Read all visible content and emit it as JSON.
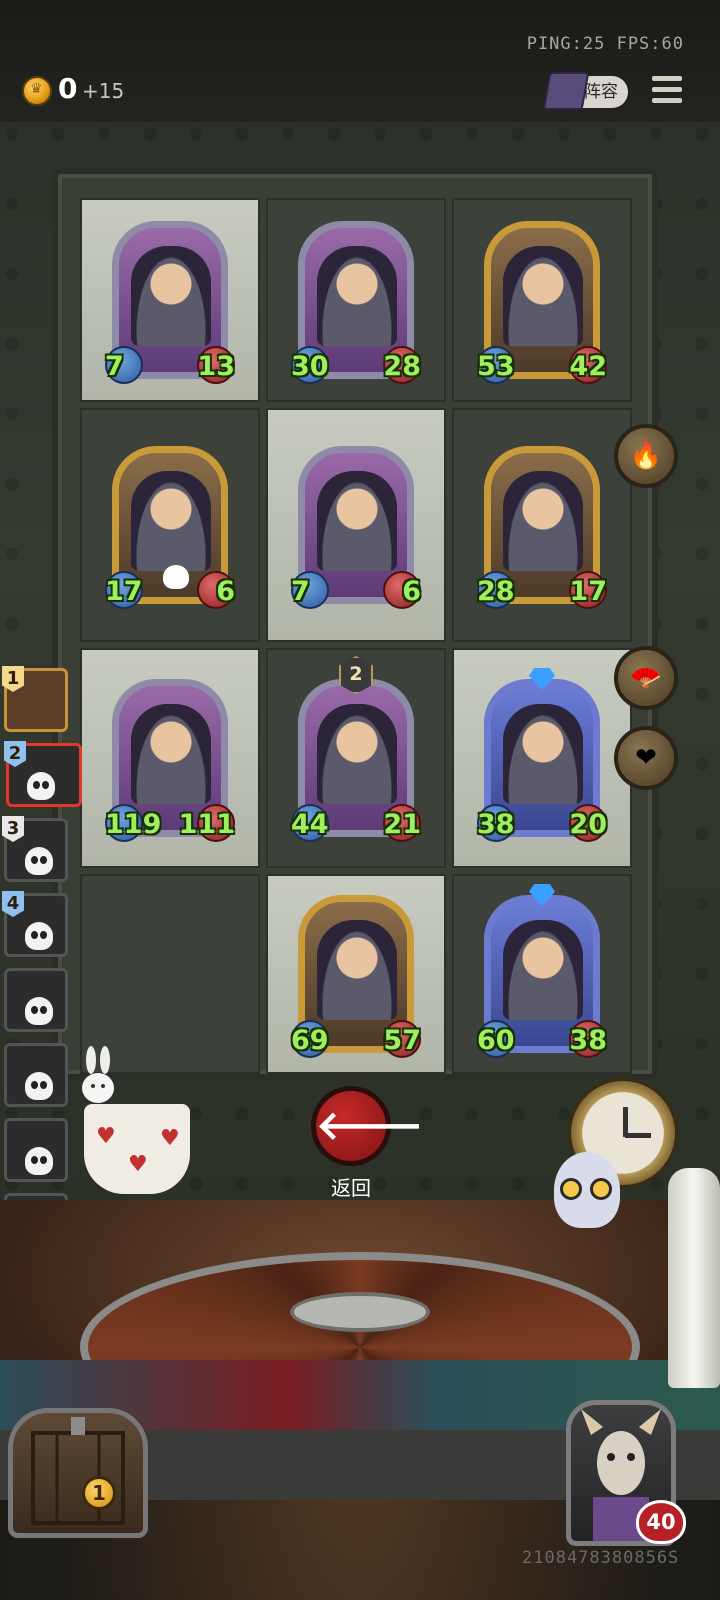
{
  "topbar": {
    "ping_fps": "PING:25  FPS:60",
    "gold": "0",
    "gold_income": "+15",
    "lineup_label": "阵容"
  },
  "board": {
    "cards": [
      {
        "row": 0,
        "col": 0,
        "attack": "7",
        "health": "13",
        "frame": "silver",
        "tier_gem": false,
        "level": null
      },
      {
        "row": 0,
        "col": 1,
        "attack": "30",
        "health": "28",
        "frame": "silver",
        "tier_gem": false,
        "level": null
      },
      {
        "row": 0,
        "col": 2,
        "attack": "53",
        "health": "42",
        "frame": "gold",
        "tier_gem": false,
        "level": null
      },
      {
        "row": 1,
        "col": 0,
        "attack": "17",
        "health": "6",
        "frame": "gold",
        "tier_gem": false,
        "level": null
      },
      {
        "row": 1,
        "col": 1,
        "attack": "7",
        "health": "6",
        "frame": "silver",
        "tier_gem": false,
        "level": null
      },
      {
        "row": 1,
        "col": 2,
        "attack": "28",
        "health": "17",
        "frame": "gold",
        "tier_gem": false,
        "level": null
      },
      {
        "row": 2,
        "col": 0,
        "attack": "119",
        "health": "111",
        "frame": "silver",
        "tier_gem": false,
        "level": null
      },
      {
        "row": 2,
        "col": 1,
        "attack": "44",
        "health": "21",
        "frame": "silver",
        "tier_gem": false,
        "level": "2"
      },
      {
        "row": 2,
        "col": 2,
        "attack": "38",
        "health": "20",
        "frame": "blue",
        "tier_gem": true,
        "level": null
      },
      {
        "row": 3,
        "col": 1,
        "attack": "69",
        "health": "57",
        "frame": "gold",
        "tier_gem": false,
        "level": null
      },
      {
        "row": 3,
        "col": 2,
        "attack": "60",
        "health": "38",
        "frame": "blue",
        "tier_gem": true,
        "level": null
      }
    ]
  },
  "side_buttons": [
    {
      "name": "cauldron-item",
      "icon": "cauldron-icon",
      "glyph": "🔥"
    },
    {
      "name": "fan-item",
      "icon": "fan-icon",
      "glyph": "🪭"
    },
    {
      "name": "heart-emblem-item",
      "icon": "heart-emblem-icon",
      "glyph": "❤"
    }
  ],
  "players": [
    {
      "rank": "1",
      "state": "alive",
      "me": true
    },
    {
      "rank": "2",
      "state": "dead",
      "active": true
    },
    {
      "rank": "3",
      "state": "dead"
    },
    {
      "rank": "4",
      "state": "dead"
    },
    {
      "rank": "",
      "state": "dead"
    },
    {
      "rank": "",
      "state": "dead"
    },
    {
      "rank": "",
      "state": "dead"
    },
    {
      "rank": "",
      "state": "dead"
    }
  ],
  "back": {
    "label": "返回",
    "icon": "arrow-left-icon"
  },
  "chest": {
    "count": "1"
  },
  "hero": {
    "health": "40"
  },
  "player_id": "2108478380856S",
  "colors": {
    "stat_green": "#9ff05c",
    "back_red": "#c72a28",
    "gold": "#e39a14"
  }
}
